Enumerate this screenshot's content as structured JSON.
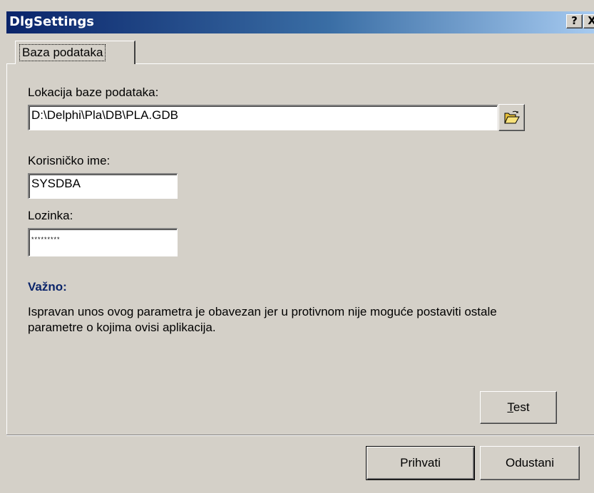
{
  "window": {
    "title": "DlgSettings",
    "help_label": "?",
    "close_label": "X"
  },
  "tabs": [
    {
      "label": "Baza podataka",
      "active": true
    }
  ],
  "form": {
    "db_location_label": "Lokacija baze podataka:",
    "db_location_value": "D:\\Delphi\\Pla\\DB\\PLA.GDB",
    "username_label": "Korisničko ime:",
    "username_value": "SYSDBA",
    "password_label": "Lozinka:",
    "password_value": "*********"
  },
  "note": {
    "heading": "Važno:",
    "text": "Ispravan unos ovog parametra je obavezan jer u protivnom nije moguće postaviti ostale parametre o kojima ovisi aplikacija."
  },
  "buttons": {
    "test": "Test",
    "accept": "Prihvati",
    "cancel": "Odustani"
  },
  "icons": {
    "browse": "open-folder-icon"
  }
}
